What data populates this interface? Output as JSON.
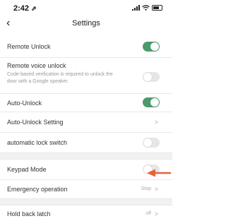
{
  "status": {
    "time": "2:42",
    "location_glyph": "⇗"
  },
  "nav": {
    "title": "Settings",
    "back_glyph": "‹"
  },
  "rows": {
    "remote_unlock": {
      "label": "Remote Unlock",
      "on": true
    },
    "remote_voice": {
      "label": "Remote voice unlock",
      "sub": "Code-based verification is required to unlock the door with a Google speaker.",
      "on": false
    },
    "auto_unlock": {
      "label": "Auto-Unlock",
      "on": true
    },
    "auto_unlock_setting": {
      "label": "Auto-Unlock Setting",
      "chevron": ">"
    },
    "auto_lock_switch": {
      "label": "automatic lock switch",
      "on": false
    },
    "keypad_mode": {
      "label": "Keypad Mode",
      "on": false
    },
    "emergency": {
      "label": "Emergency operation",
      "value": "Stop",
      "chevron": ">"
    },
    "hold_back": {
      "label": "Hold back latch",
      "value": "off",
      "chevron": ">"
    }
  },
  "colors": {
    "toggle_on": "#4d9a6c",
    "toggle_off": "#e6e6e6",
    "arrow": "#e8613a"
  }
}
